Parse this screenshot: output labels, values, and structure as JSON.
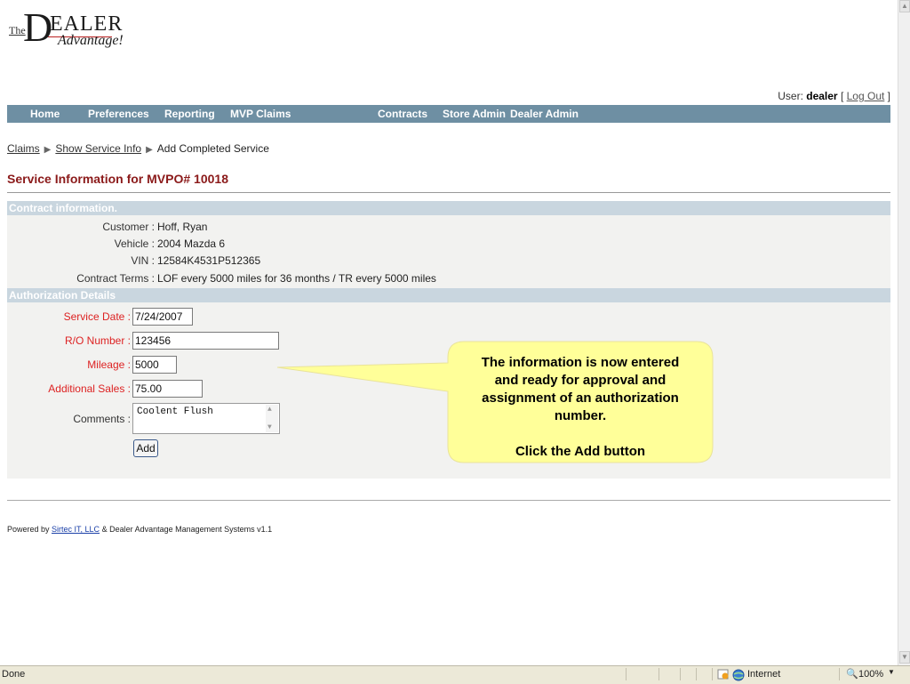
{
  "logo": {
    "the": "The",
    "dealer_initial": "D",
    "dealer_rest": "EALER",
    "advantage": "Advantage!"
  },
  "user": {
    "prefix": "User: ",
    "name": "dealer",
    "open": " [ ",
    "logout": "Log Out",
    "close": " ]"
  },
  "nav": {
    "home": "Home",
    "preferences": "Preferences",
    "reporting": "Reporting",
    "mvp_claims": "MVP Claims",
    "contracts": "Contracts",
    "store_admin": "Store Admin",
    "dealer_admin": "Dealer Admin"
  },
  "breadcrumb": {
    "claims": "Claims",
    "sep": "▶",
    "show_service": "Show Service Info",
    "current": "Add Completed Service"
  },
  "page_title": "Service Information for MVPO# 10018",
  "contract": {
    "header": "Contract information.",
    "customer_label": "Customer :",
    "customer_value": "Hoff, Ryan",
    "vehicle_label": "Vehicle :",
    "vehicle_value": "2004 Mazda 6",
    "vin_label": "VIN :",
    "vin_value": "12584K4531P512365",
    "terms_label": "Contract Terms :",
    "terms_value": "LOF every 5000 miles for 36 months / TR every 5000 miles"
  },
  "auth": {
    "header": "Authorization Details",
    "service_date_label": "Service Date :",
    "service_date_value": "7/24/2007",
    "ro_label": "R/O Number :",
    "ro_value": "123456",
    "mileage_label": "Mileage :",
    "mileage_value": "5000",
    "sales_label": "Additional Sales :",
    "sales_value": "75.00",
    "comments_label": "Comments :",
    "comments_value": "Coolent Flush",
    "add_button": "Add"
  },
  "callout": {
    "line1": "The information is now entered",
    "line2": "and ready for approval and",
    "line3": "assignment of an authorization",
    "line4": "number.",
    "line5": "Click the Add button"
  },
  "footer": {
    "prefix": "Powered by ",
    "link": "Sirtec IT, LLC",
    "suffix": " & Dealer Advantage Management Systems v1.1"
  },
  "statusbar": {
    "left": "Done",
    "zone": "Internet",
    "zoom": "100%"
  },
  "colors": {
    "nav_bg": "#6e8fa3",
    "section_bg": "#c9d6df",
    "title": "#8b1a1a",
    "required_label": "#dd2222",
    "callout_bg": "#ffff99"
  }
}
